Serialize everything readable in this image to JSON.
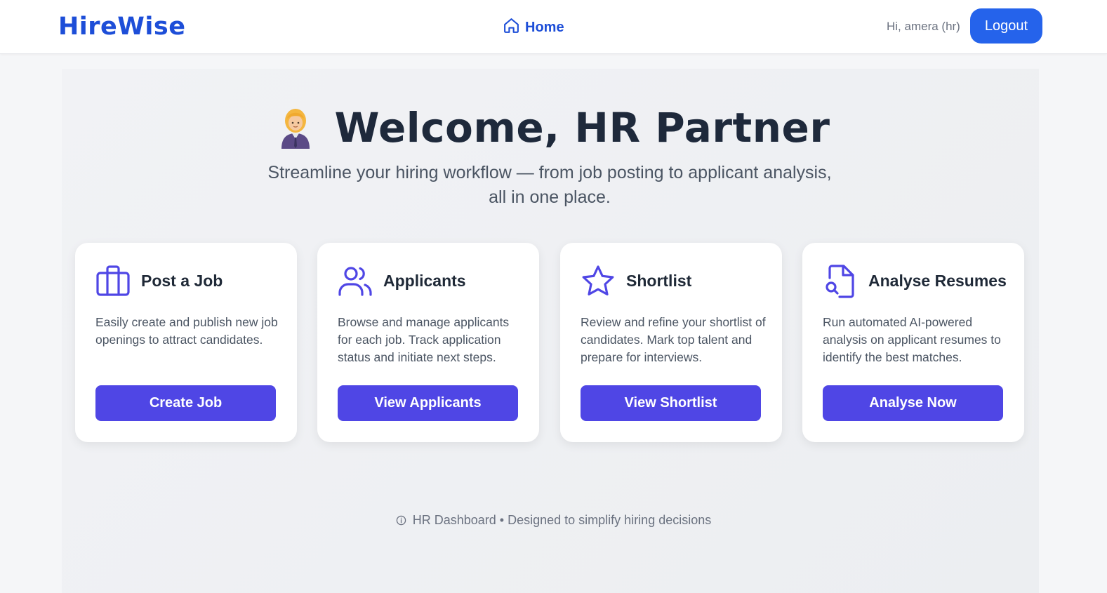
{
  "nav": {
    "brand": "HireWise",
    "home_label": "Home",
    "greeting": "Hi, amera (hr)",
    "logout_label": "Logout"
  },
  "hero": {
    "emoji": "office-worker-woman-emoji",
    "title": "Welcome, HR Partner",
    "subtitle": "Streamline your hiring workflow — from job posting to applicant analysis, all in one place."
  },
  "cards": [
    {
      "icon": "briefcase-icon",
      "title": "Post a Job",
      "description": "Easily create and publish new job openings to attract candidates.",
      "button": "Create Job"
    },
    {
      "icon": "users-icon",
      "title": "Applicants",
      "description": "Browse and manage applicants for each job. Track application status and initiate next steps.",
      "button": "View Applicants"
    },
    {
      "icon": "star-icon",
      "title": "Shortlist",
      "description": "Review and refine your shortlist of candidates. Mark top talent and prepare for interviews.",
      "button": "View Shortlist"
    },
    {
      "icon": "document-search-icon",
      "title": "Analyse Resumes",
      "description": "Run automated AI-powered analysis on applicant resumes to identify the best matches.",
      "button": "Analyse Now"
    }
  ],
  "footer": {
    "icon": "info-icon",
    "text": "HR Dashboard • Designed to simplify hiring decisions"
  },
  "colors": {
    "brand": "#1d4ed8",
    "logout_bg": "#2563eb",
    "primary_button": "#4f46e5",
    "icon_color": "#4f46e5",
    "heading": "#1e293b"
  }
}
